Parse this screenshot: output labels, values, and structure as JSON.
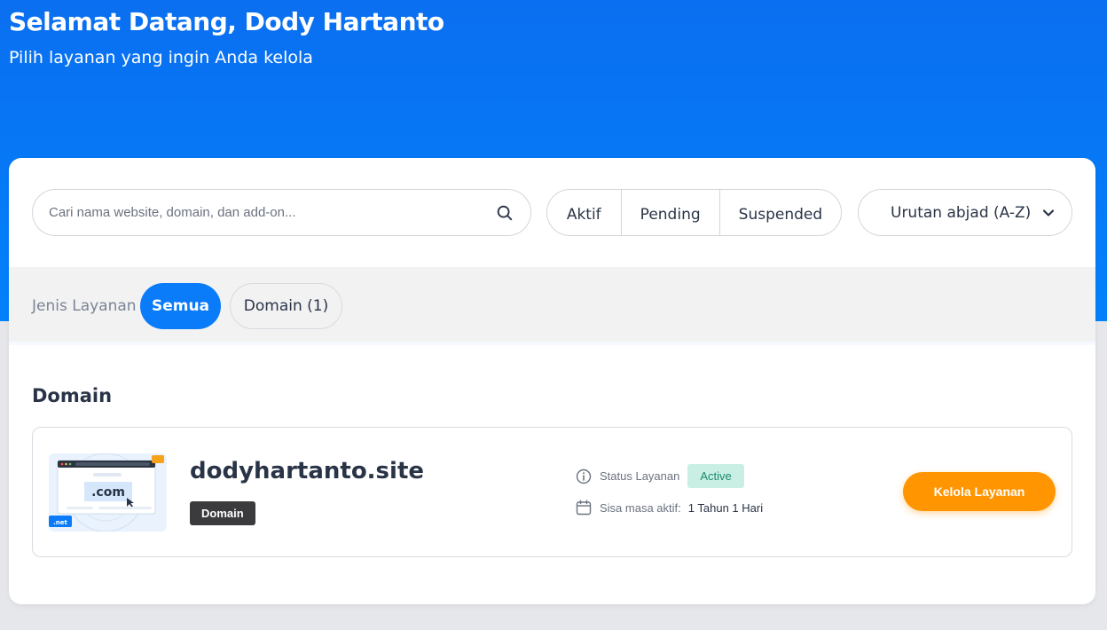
{
  "header": {
    "title": "Selamat Datang, Dody Hartanto",
    "subtitle": "Pilih layanan yang ingin Anda kelola"
  },
  "search": {
    "placeholder": "Cari nama website, domain, dan add-on...",
    "icon": "search-icon"
  },
  "status_filters": [
    "Aktif",
    "Pending",
    "Suspended"
  ],
  "sort": {
    "label": "Urutan abjad (A-Z)",
    "icon": "chevron-down-icon"
  },
  "service_type_filter": {
    "label": "Jenis Layanan",
    "options": [
      "Semua",
      "Domain (1)"
    ],
    "selected": "Semua"
  },
  "sections": [
    {
      "title": "Domain",
      "services": [
        {
          "name": "dodyhartanto.site",
          "badge": "Domain",
          "thumbnail_text": ".com",
          "thumbnail_tag": ".net",
          "status_label": "Status Layanan",
          "status": "Active",
          "expiry_label": "Sisa masa aktif:",
          "expiry_value": "1 Tahun 1 Hari",
          "action_label": "Kelola Layanan"
        }
      ]
    }
  ],
  "colors": {
    "hero": "#0a7cf9",
    "primary": "#0a7cf9",
    "action": "#ff9500",
    "status_active_bg": "#c9efe5",
    "status_active_text": "#1b8a6b"
  }
}
